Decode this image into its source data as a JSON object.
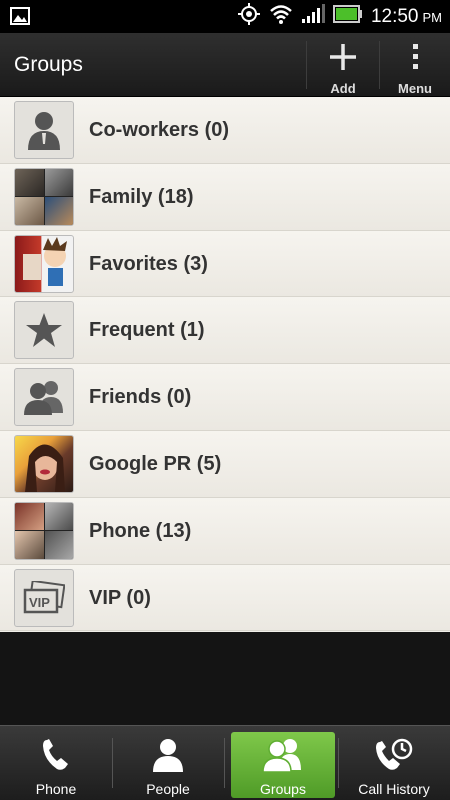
{
  "status_bar": {
    "time": "12:50",
    "ampm": "PM",
    "icons": [
      "image-notification-icon",
      "gps-icon",
      "wifi-icon",
      "signal-icon",
      "battery-icon"
    ]
  },
  "action_bar": {
    "title": "Groups",
    "add_label": "Add",
    "menu_label": "Menu"
  },
  "groups": [
    {
      "name": "Co-workers (0)",
      "thumb": "person-icon"
    },
    {
      "name": "Family (18)",
      "thumb": "photo-collage"
    },
    {
      "name": "Favorites (3)",
      "thumb": "photo"
    },
    {
      "name": "Frequent (1)",
      "thumb": "star-icon"
    },
    {
      "name": "Friends (0)",
      "thumb": "people-icon"
    },
    {
      "name": "Google PR (5)",
      "thumb": "photo"
    },
    {
      "name": "Phone (13)",
      "thumb": "photo-collage"
    },
    {
      "name": "VIP (0)",
      "thumb": "vip-icon"
    }
  ],
  "tabs": [
    {
      "label": "Phone",
      "icon": "phone-icon",
      "active": false
    },
    {
      "label": "People",
      "icon": "person-icon",
      "active": false
    },
    {
      "label": "Groups",
      "icon": "people-icon",
      "active": true
    },
    {
      "label": "Call History",
      "icon": "call-history-icon",
      "active": false
    }
  ],
  "colors": {
    "active_tab": "#5fae32",
    "list_bg": "#f1efe9",
    "bar_bg": "#1d1d1d"
  }
}
